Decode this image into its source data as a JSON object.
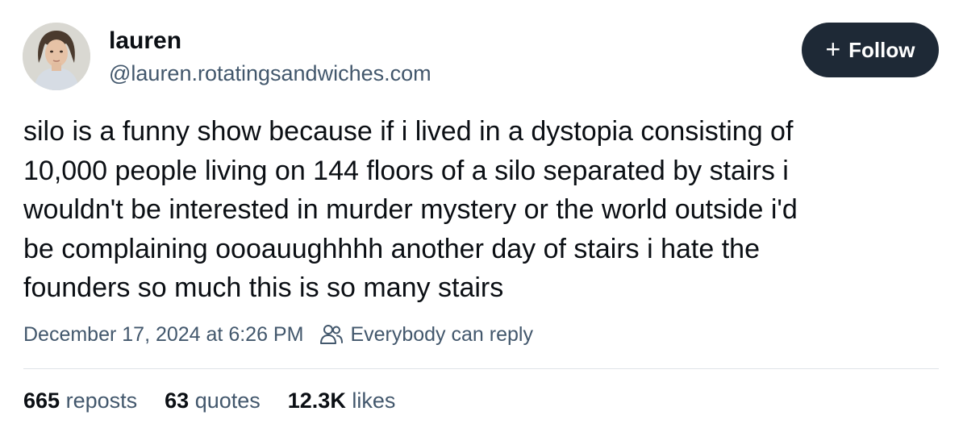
{
  "author": {
    "display_name": "lauren",
    "handle": "@lauren.rotatingsandwiches.com"
  },
  "follow_button": {
    "icon": "plus-icon",
    "icon_glyph": "+",
    "label": "Follow"
  },
  "post": {
    "text": "silo is a funny show because if i lived in a dystopia consisting of\n10,000 people living on 144 floors of a silo separated by stairs i\nwouldn't be interested in murder mystery or the world outside i'd\nbe complaining oooauughhhh another day of stairs i hate the\nfounders so much this is so many stairs",
    "timestamp": "December 17, 2024 at 6:26 PM",
    "reply_setting_icon": "people-icon",
    "reply_setting": "Everybody can reply"
  },
  "stats": {
    "reposts": {
      "count": "665",
      "label": "reposts"
    },
    "quotes": {
      "count": "63",
      "label": "quotes"
    },
    "likes": {
      "count": "12.3K",
      "label": "likes"
    }
  },
  "colors": {
    "text": "#0b0f14",
    "secondary": "#42576c",
    "button_bg": "#1e2936",
    "divider": "#dfe3e8"
  }
}
